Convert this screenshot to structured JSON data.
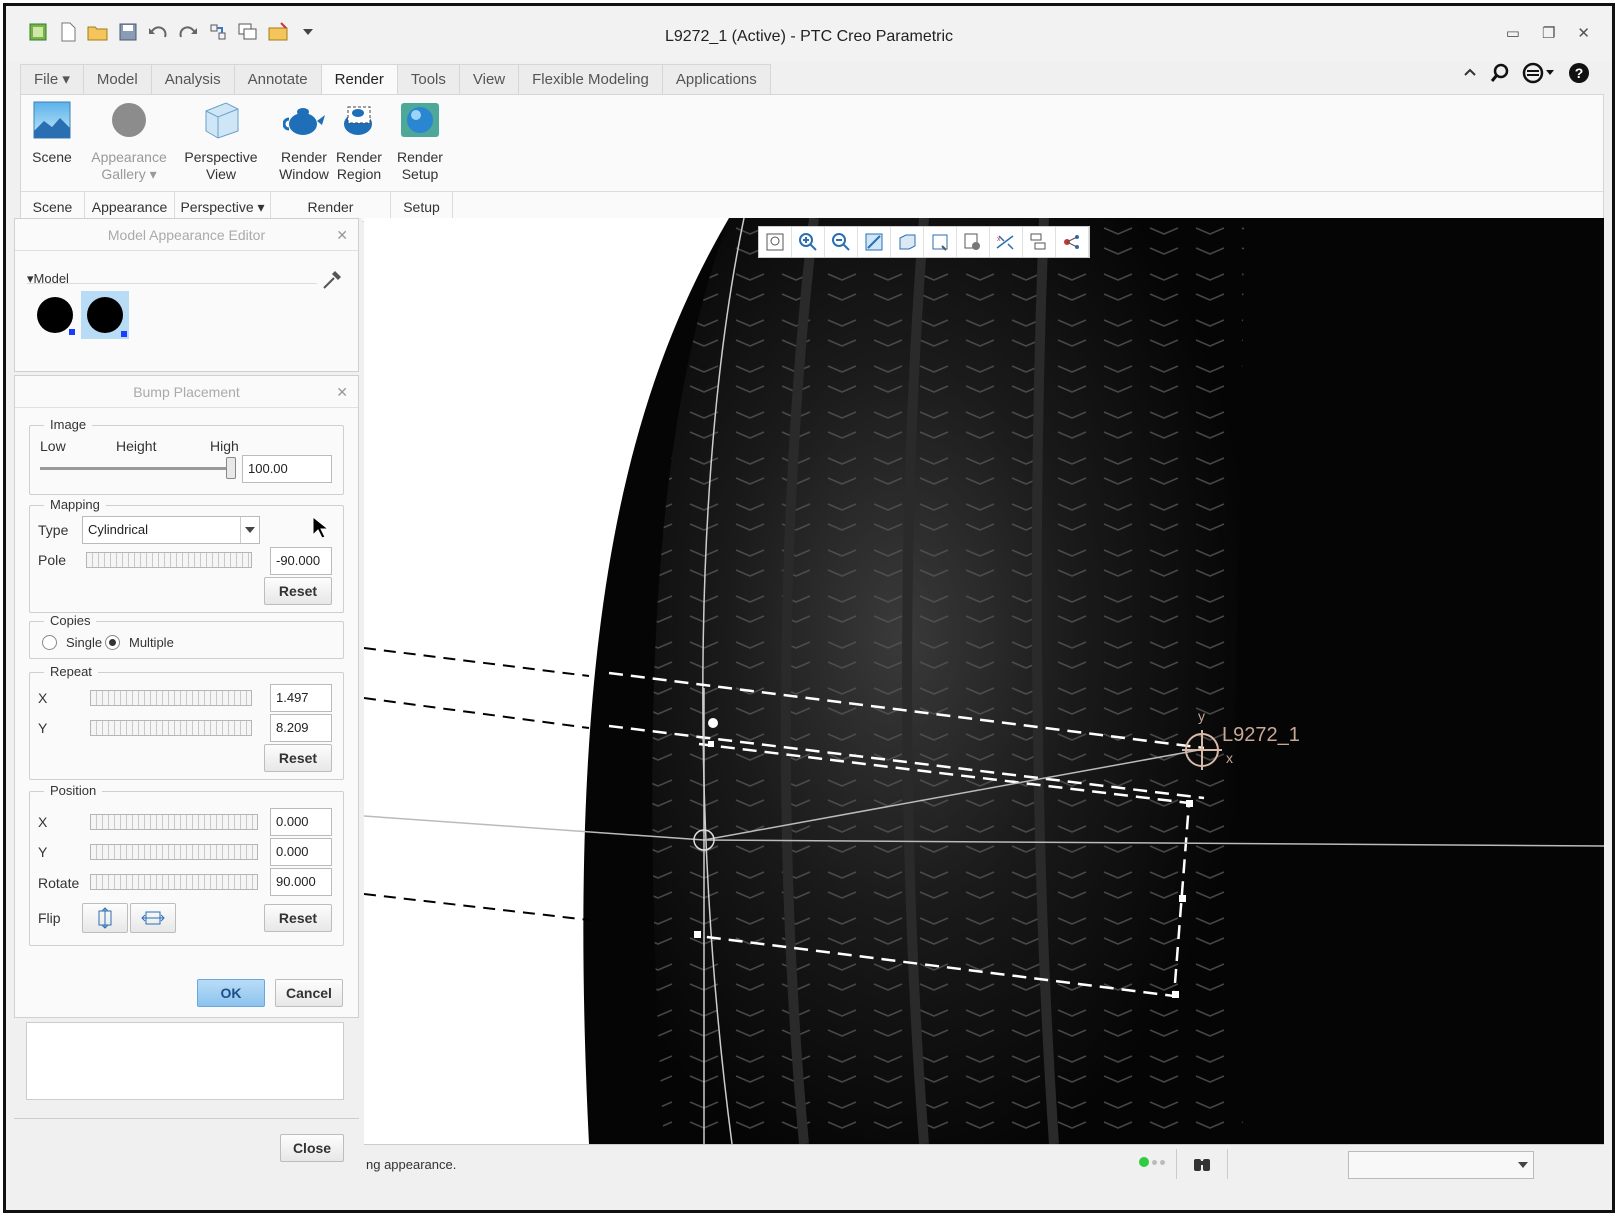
{
  "window": {
    "title": "L9272_1 (Active) - PTC Creo Parametric",
    "controls": [
      "minimize-icon",
      "restore-icon",
      "close-icon"
    ]
  },
  "quick_access": [
    "app-icon",
    "new-icon",
    "open-icon",
    "save-icon",
    "undo-icon",
    "redo-icon",
    "regenerate-icon",
    "windows-icon",
    "close-window-icon",
    "customize-icon"
  ],
  "tabs": [
    {
      "label": "File ▾"
    },
    {
      "label": "Model"
    },
    {
      "label": "Analysis"
    },
    {
      "label": "Annotate"
    },
    {
      "label": "Render",
      "active": true
    },
    {
      "label": "Tools"
    },
    {
      "label": "View"
    },
    {
      "label": "Flexible Modeling"
    },
    {
      "label": "Applications"
    }
  ],
  "ribbon": {
    "buttons": [
      {
        "line1": "Scene",
        "line2": ""
      },
      {
        "line1": "Appearance",
        "line2": "Gallery ▾"
      },
      {
        "line1": "Perspective",
        "line2": "View"
      },
      {
        "line1": "Render",
        "line2": "Window"
      },
      {
        "line1": "Render",
        "line2": "Region"
      },
      {
        "line1": "Render",
        "line2": "Setup"
      }
    ],
    "groups": [
      "Scene",
      "Appearance",
      "Perspective ▾",
      "Render",
      "Setup"
    ]
  },
  "appearance_editor": {
    "title": "Model Appearance Editor",
    "section": "Model"
  },
  "bump_placement": {
    "title": "Bump Placement",
    "image": {
      "legend": "Image",
      "low": "Low",
      "height": "Height",
      "high": "High",
      "value": "100.00",
      "level": 1.0
    },
    "mapping": {
      "legend": "Mapping",
      "type_label": "Type",
      "type_value": "Cylindrical",
      "pole_label": "Pole",
      "pole_value": "-90.000",
      "reset": "Reset"
    },
    "copies": {
      "legend": "Copies",
      "single": "Single",
      "multiple": "Multiple",
      "selected": "Multiple"
    },
    "repeat": {
      "legend": "Repeat",
      "x_label": "X",
      "x_value": "1.497",
      "y_label": "Y",
      "y_value": "8.209",
      "reset": "Reset"
    },
    "position": {
      "legend": "Position",
      "x_label": "X",
      "x_value": "0.000",
      "y_label": "Y",
      "y_value": "0.000",
      "rotate_label": "Rotate",
      "rotate_value": "90.000",
      "flip_label": "Flip",
      "reset": "Reset"
    },
    "ok": "OK",
    "cancel": "Cancel"
  },
  "close": "Close",
  "viewport": {
    "model_label": "L9272_1",
    "csys_y": "y",
    "csys_x": "x"
  },
  "status": {
    "message": "ng appearance."
  }
}
